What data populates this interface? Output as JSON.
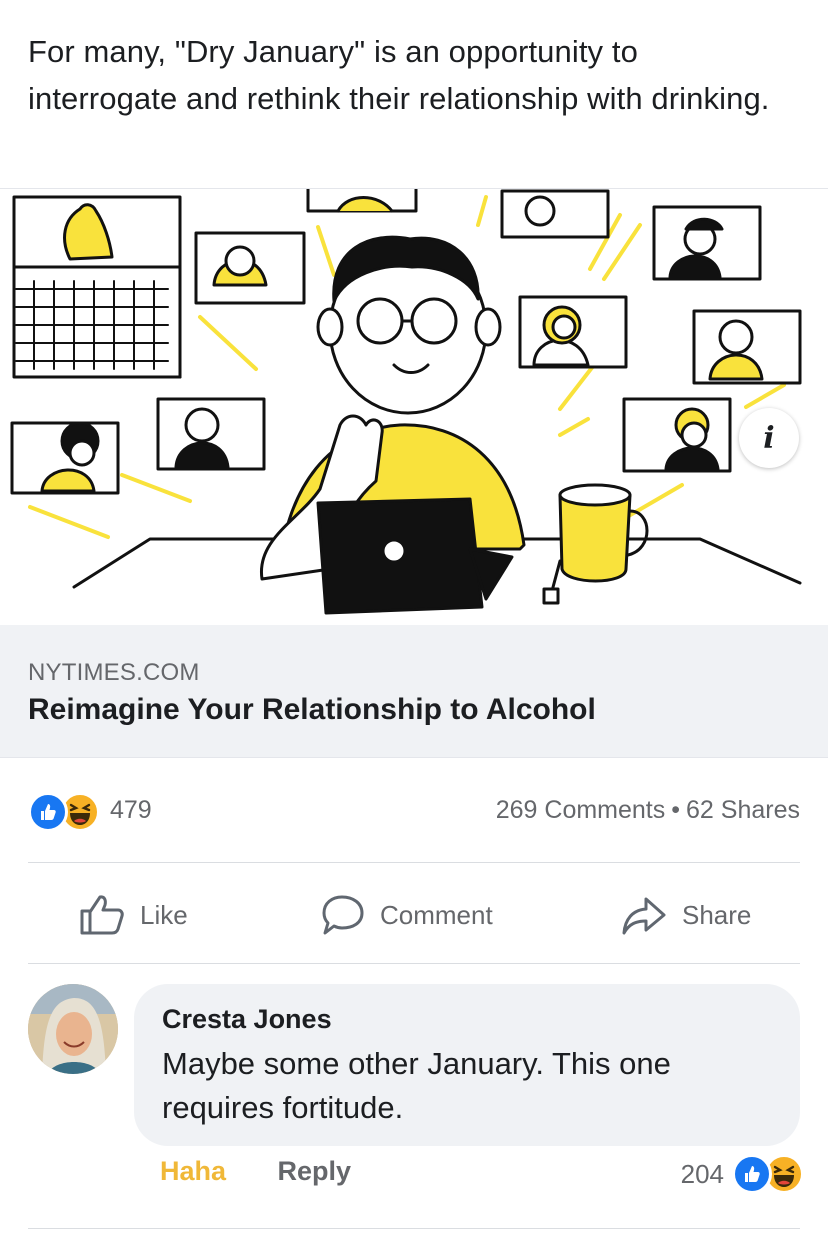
{
  "post": {
    "text": "For many, \"Dry January\" is an opportunity to interrogate and rethink their relationship with drinking."
  },
  "link": {
    "domain": "NYTIMES.COM",
    "title": "Reimagine Your Relationship to Alcohol",
    "info_icon": "i"
  },
  "reactions": {
    "count": "479",
    "comments": "269 Comments",
    "separator": "•",
    "shares": "62 Shares",
    "icons": [
      "like-icon",
      "haha-icon"
    ]
  },
  "actions": {
    "like": "Like",
    "comment": "Comment",
    "share": "Share"
  },
  "comment": {
    "author": "Cresta Jones",
    "text": "Maybe some other January. This one requires fortitude.",
    "haha_label": "Haha",
    "reply_label": "Reply",
    "reaction_count": "204"
  },
  "colors": {
    "accent_blue": "#1877f2",
    "haha_yellow": "#f7b125",
    "illustration_yellow": "#f9e23c",
    "muted_text": "#65676b"
  }
}
